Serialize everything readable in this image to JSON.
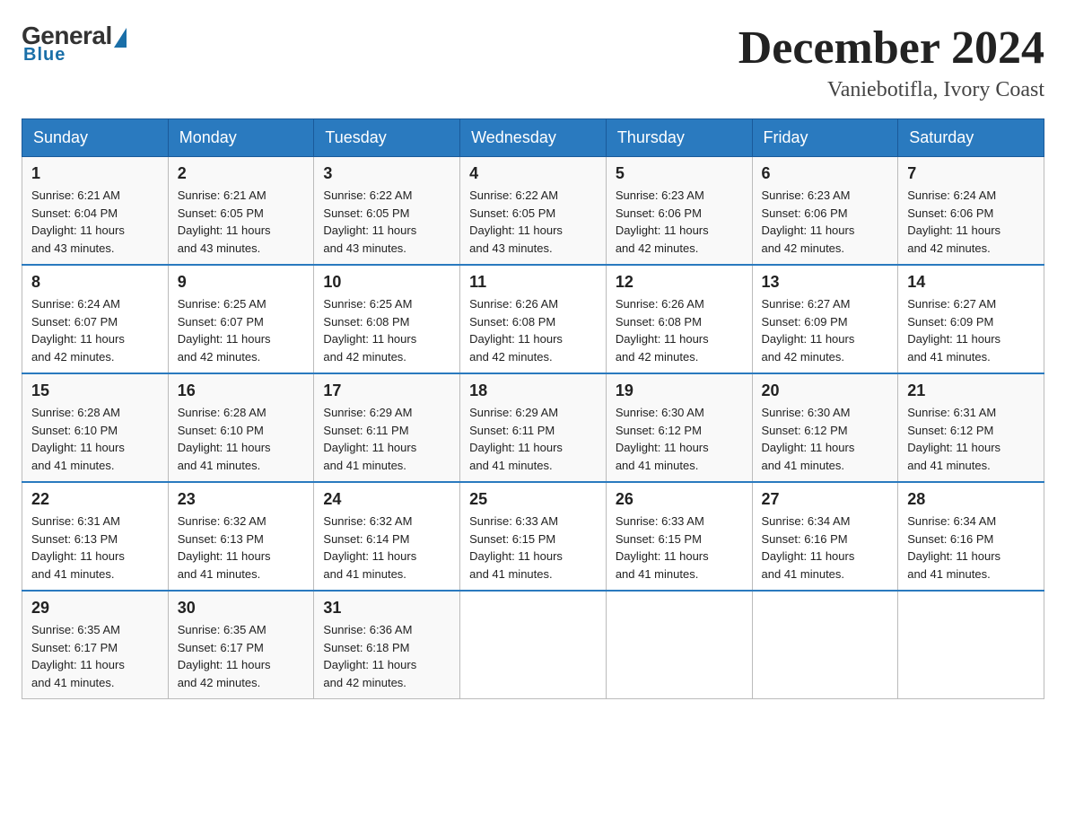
{
  "logo": {
    "general": "General",
    "blue": "Blue",
    "underline": "Blue"
  },
  "title": "December 2024",
  "subtitle": "Vaniebotifla, Ivory Coast",
  "days_of_week": [
    "Sunday",
    "Monday",
    "Tuesday",
    "Wednesday",
    "Thursday",
    "Friday",
    "Saturday"
  ],
  "weeks": [
    [
      {
        "day": "1",
        "sunrise": "6:21 AM",
        "sunset": "6:04 PM",
        "daylight": "11 hours and 43 minutes."
      },
      {
        "day": "2",
        "sunrise": "6:21 AM",
        "sunset": "6:05 PM",
        "daylight": "11 hours and 43 minutes."
      },
      {
        "day": "3",
        "sunrise": "6:22 AM",
        "sunset": "6:05 PM",
        "daylight": "11 hours and 43 minutes."
      },
      {
        "day": "4",
        "sunrise": "6:22 AM",
        "sunset": "6:05 PM",
        "daylight": "11 hours and 43 minutes."
      },
      {
        "day": "5",
        "sunrise": "6:23 AM",
        "sunset": "6:06 PM",
        "daylight": "11 hours and 42 minutes."
      },
      {
        "day": "6",
        "sunrise": "6:23 AM",
        "sunset": "6:06 PM",
        "daylight": "11 hours and 42 minutes."
      },
      {
        "day": "7",
        "sunrise": "6:24 AM",
        "sunset": "6:06 PM",
        "daylight": "11 hours and 42 minutes."
      }
    ],
    [
      {
        "day": "8",
        "sunrise": "6:24 AM",
        "sunset": "6:07 PM",
        "daylight": "11 hours and 42 minutes."
      },
      {
        "day": "9",
        "sunrise": "6:25 AM",
        "sunset": "6:07 PM",
        "daylight": "11 hours and 42 minutes."
      },
      {
        "day": "10",
        "sunrise": "6:25 AM",
        "sunset": "6:08 PM",
        "daylight": "11 hours and 42 minutes."
      },
      {
        "day": "11",
        "sunrise": "6:26 AM",
        "sunset": "6:08 PM",
        "daylight": "11 hours and 42 minutes."
      },
      {
        "day": "12",
        "sunrise": "6:26 AM",
        "sunset": "6:08 PM",
        "daylight": "11 hours and 42 minutes."
      },
      {
        "day": "13",
        "sunrise": "6:27 AM",
        "sunset": "6:09 PM",
        "daylight": "11 hours and 42 minutes."
      },
      {
        "day": "14",
        "sunrise": "6:27 AM",
        "sunset": "6:09 PM",
        "daylight": "11 hours and 41 minutes."
      }
    ],
    [
      {
        "day": "15",
        "sunrise": "6:28 AM",
        "sunset": "6:10 PM",
        "daylight": "11 hours and 41 minutes."
      },
      {
        "day": "16",
        "sunrise": "6:28 AM",
        "sunset": "6:10 PM",
        "daylight": "11 hours and 41 minutes."
      },
      {
        "day": "17",
        "sunrise": "6:29 AM",
        "sunset": "6:11 PM",
        "daylight": "11 hours and 41 minutes."
      },
      {
        "day": "18",
        "sunrise": "6:29 AM",
        "sunset": "6:11 PM",
        "daylight": "11 hours and 41 minutes."
      },
      {
        "day": "19",
        "sunrise": "6:30 AM",
        "sunset": "6:12 PM",
        "daylight": "11 hours and 41 minutes."
      },
      {
        "day": "20",
        "sunrise": "6:30 AM",
        "sunset": "6:12 PM",
        "daylight": "11 hours and 41 minutes."
      },
      {
        "day": "21",
        "sunrise": "6:31 AM",
        "sunset": "6:12 PM",
        "daylight": "11 hours and 41 minutes."
      }
    ],
    [
      {
        "day": "22",
        "sunrise": "6:31 AM",
        "sunset": "6:13 PM",
        "daylight": "11 hours and 41 minutes."
      },
      {
        "day": "23",
        "sunrise": "6:32 AM",
        "sunset": "6:13 PM",
        "daylight": "11 hours and 41 minutes."
      },
      {
        "day": "24",
        "sunrise": "6:32 AM",
        "sunset": "6:14 PM",
        "daylight": "11 hours and 41 minutes."
      },
      {
        "day": "25",
        "sunrise": "6:33 AM",
        "sunset": "6:15 PM",
        "daylight": "11 hours and 41 minutes."
      },
      {
        "day": "26",
        "sunrise": "6:33 AM",
        "sunset": "6:15 PM",
        "daylight": "11 hours and 41 minutes."
      },
      {
        "day": "27",
        "sunrise": "6:34 AM",
        "sunset": "6:16 PM",
        "daylight": "11 hours and 41 minutes."
      },
      {
        "day": "28",
        "sunrise": "6:34 AM",
        "sunset": "6:16 PM",
        "daylight": "11 hours and 41 minutes."
      }
    ],
    [
      {
        "day": "29",
        "sunrise": "6:35 AM",
        "sunset": "6:17 PM",
        "daylight": "11 hours and 41 minutes."
      },
      {
        "day": "30",
        "sunrise": "6:35 AM",
        "sunset": "6:17 PM",
        "daylight": "11 hours and 42 minutes."
      },
      {
        "day": "31",
        "sunrise": "6:36 AM",
        "sunset": "6:18 PM",
        "daylight": "11 hours and 42 minutes."
      },
      null,
      null,
      null,
      null
    ]
  ],
  "labels": {
    "sunrise": "Sunrise:",
    "sunset": "Sunset:",
    "daylight": "Daylight:"
  }
}
